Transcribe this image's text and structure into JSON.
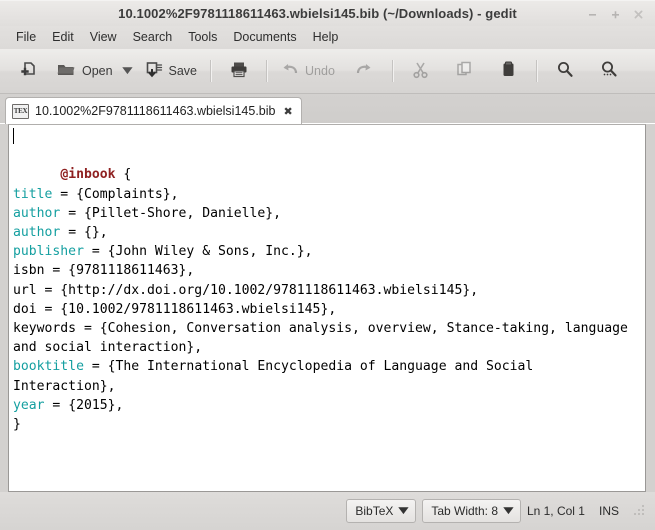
{
  "window": {
    "title": "10.1002%2F9781118611463.wbielsi145.bib (~/Downloads) - gedit",
    "controls": {
      "minimize": "minimize-icon",
      "maximize": "maximize-icon",
      "close": "close-icon"
    }
  },
  "menubar": {
    "items": [
      {
        "label": "File"
      },
      {
        "label": "Edit"
      },
      {
        "label": "View"
      },
      {
        "label": "Search"
      },
      {
        "label": "Tools"
      },
      {
        "label": "Documents"
      },
      {
        "label": "Help"
      }
    ]
  },
  "toolbar": {
    "new_label": "",
    "new_icon": "new-document-icon",
    "open_label": "Open",
    "open_icon": "open-folder-icon",
    "open_dropdown_icon": "chevron-down-icon",
    "save_label": "Save",
    "save_icon": "save-icon",
    "print_icon": "print-icon",
    "undo_label": "Undo",
    "undo_icon": "undo-icon",
    "redo_icon": "redo-icon",
    "cut_icon": "cut-icon",
    "copy_icon": "copy-icon",
    "paste_icon": "paste-icon",
    "find_icon": "search-icon",
    "replace_icon": "find-replace-icon"
  },
  "tabs": [
    {
      "label": "10.1002%2F9781118611463.wbielsi145.bib",
      "icon": "TEX",
      "icon_name": "tex-file-icon",
      "close_glyph": "✖",
      "active": true
    }
  ],
  "editor": {
    "lines": [
      [
        {
          "t": "@inbook",
          "c": "at"
        },
        {
          "t": " {",
          "c": "plain"
        }
      ],
      [
        {
          "t": "title",
          "c": "key"
        },
        {
          "t": " = {Complaints},",
          "c": "plain"
        }
      ],
      [
        {
          "t": "author",
          "c": "key"
        },
        {
          "t": " = {Pillet-Shore, Danielle},",
          "c": "plain"
        }
      ],
      [
        {
          "t": "author",
          "c": "key"
        },
        {
          "t": " = {},",
          "c": "plain"
        }
      ],
      [
        {
          "t": "publisher",
          "c": "key"
        },
        {
          "t": " = {John Wiley & Sons, Inc.},",
          "c": "plain"
        }
      ],
      [
        {
          "t": "isbn = {9781118611463},",
          "c": "plain"
        }
      ],
      [
        {
          "t": "url = {http://dx.doi.org/10.1002/9781118611463.wbielsi145},",
          "c": "plain"
        }
      ],
      [
        {
          "t": "doi = {10.1002/9781118611463.wbielsi145},",
          "c": "plain"
        }
      ],
      [
        {
          "t": "keywords = {Cohesion, Conversation analysis, overview, Stance-taking, language and social interaction},",
          "c": "plain"
        }
      ],
      [
        {
          "t": "booktitle",
          "c": "key"
        },
        {
          "t": " = {The International Encyclopedia of Language and Social Interaction},",
          "c": "plain"
        }
      ],
      [
        {
          "t": "year",
          "c": "key"
        },
        {
          "t": " = {2015},",
          "c": "plain"
        }
      ],
      [
        {
          "t": "}",
          "c": "plain"
        }
      ]
    ],
    "colors": {
      "entry_type": "#8f2121",
      "field_key": "#149fa0",
      "text": "#000000",
      "background": "#ffffff"
    }
  },
  "statusbar": {
    "language": "BibTeX",
    "language_arrow": "▼",
    "tab_width": "Tab Width: 8",
    "tab_width_arrow": "▼",
    "position": "Ln 1, Col 1",
    "insert_mode": "INS",
    "grip_icon": "resize-grip-icon"
  }
}
